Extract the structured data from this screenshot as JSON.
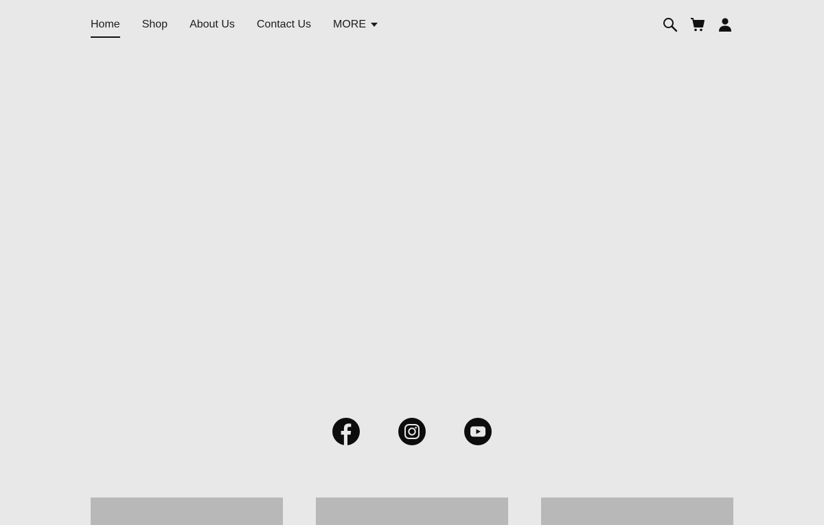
{
  "nav": {
    "items": [
      {
        "label": "Home",
        "active": true
      },
      {
        "label": "Shop",
        "active": false
      },
      {
        "label": "About Us",
        "active": false
      },
      {
        "label": "Contact Us",
        "active": false
      }
    ],
    "more_label": "MORE"
  },
  "header_icons": [
    "search-icon",
    "cart-icon",
    "account-icon"
  ],
  "social": [
    "facebook-icon",
    "instagram-icon",
    "youtube-icon"
  ],
  "colors": {
    "background": "#e8e8e8",
    "text": "#1b1b1b",
    "icon": "#0d0d0d",
    "card_placeholder": "#b8b8b8"
  }
}
